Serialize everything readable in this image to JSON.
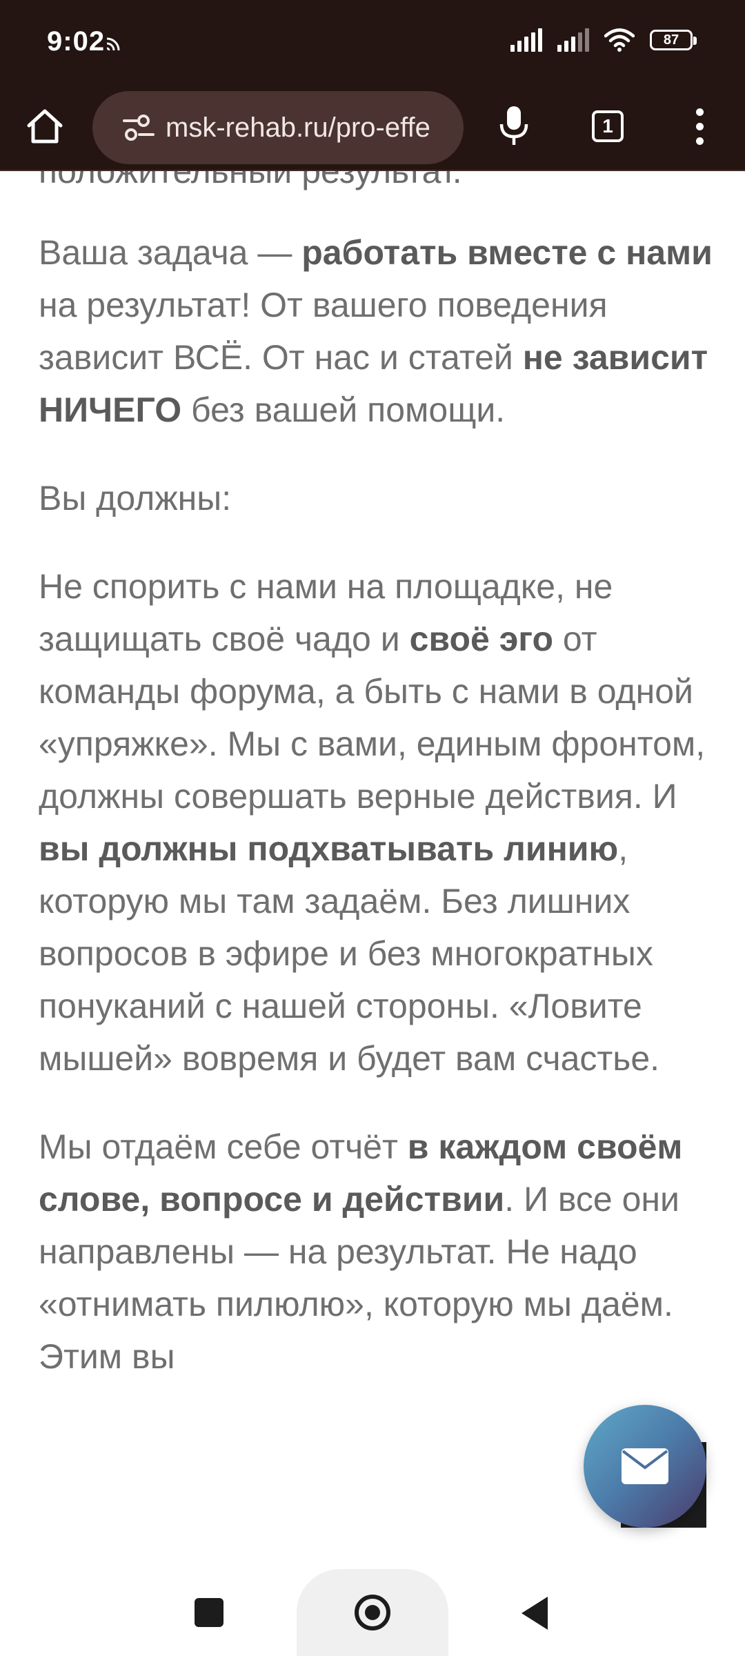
{
  "status_bar": {
    "time": "9:02",
    "battery": "87",
    "icons": [
      "cast-icon",
      "signal-icon",
      "signal-icon",
      "wifi-icon",
      "battery-icon"
    ]
  },
  "browser": {
    "url": "msk-rehab.ru/pro-effe",
    "tab_count": "1",
    "icons": [
      "home-icon",
      "site-settings-icon",
      "mic-icon",
      "tabs-icon",
      "more-vert-icon"
    ]
  },
  "article": {
    "partial_top": "положительный результат.",
    "p1": {
      "t1": "Ваша задача — ",
      "b1": "работать вместе с нами",
      "t2": " на результат! От вашего поведения зависит ВСЁ. От нас и статей ",
      "b2": "не зависит НИЧЕГО",
      "t3": " без вашей помощи."
    },
    "p2": "Вы должны:",
    "p3": {
      "t1": "Не спорить с нами на площадке, не защищать своё чадо и ",
      "b1": "своё эго",
      "t2": " от команды форума, а быть с нами в одной «упряжке». Мы с вами, единым фронтом, должны совершать верные действия. И ",
      "b2": "вы должны подхватывать линию",
      "t3": ", которую мы там задаём. Без лишних вопросов в эфире и без многократных понуканий с нашей стороны. «Ловите мышей» вовремя и будет вам счастье."
    },
    "p4": {
      "t1": "Мы отдаём себе отчёт ",
      "b1": "в каждом своём слове, вопросе и действии",
      "t2": ". И все они направлены — на результат. Не надо «отнимать пилюлю», которую мы даём. Этим вы"
    }
  },
  "fab": {
    "icon": "mail-icon"
  },
  "nav": {
    "icons": [
      "recent-apps-icon",
      "home-circle-icon",
      "back-icon"
    ]
  },
  "colors": {
    "chrome": "#241513",
    "url_bar": "#4a3330",
    "text": "#6f6f6f",
    "fab_start": "#5fa9c9",
    "fab_end": "#4a3a6a"
  }
}
